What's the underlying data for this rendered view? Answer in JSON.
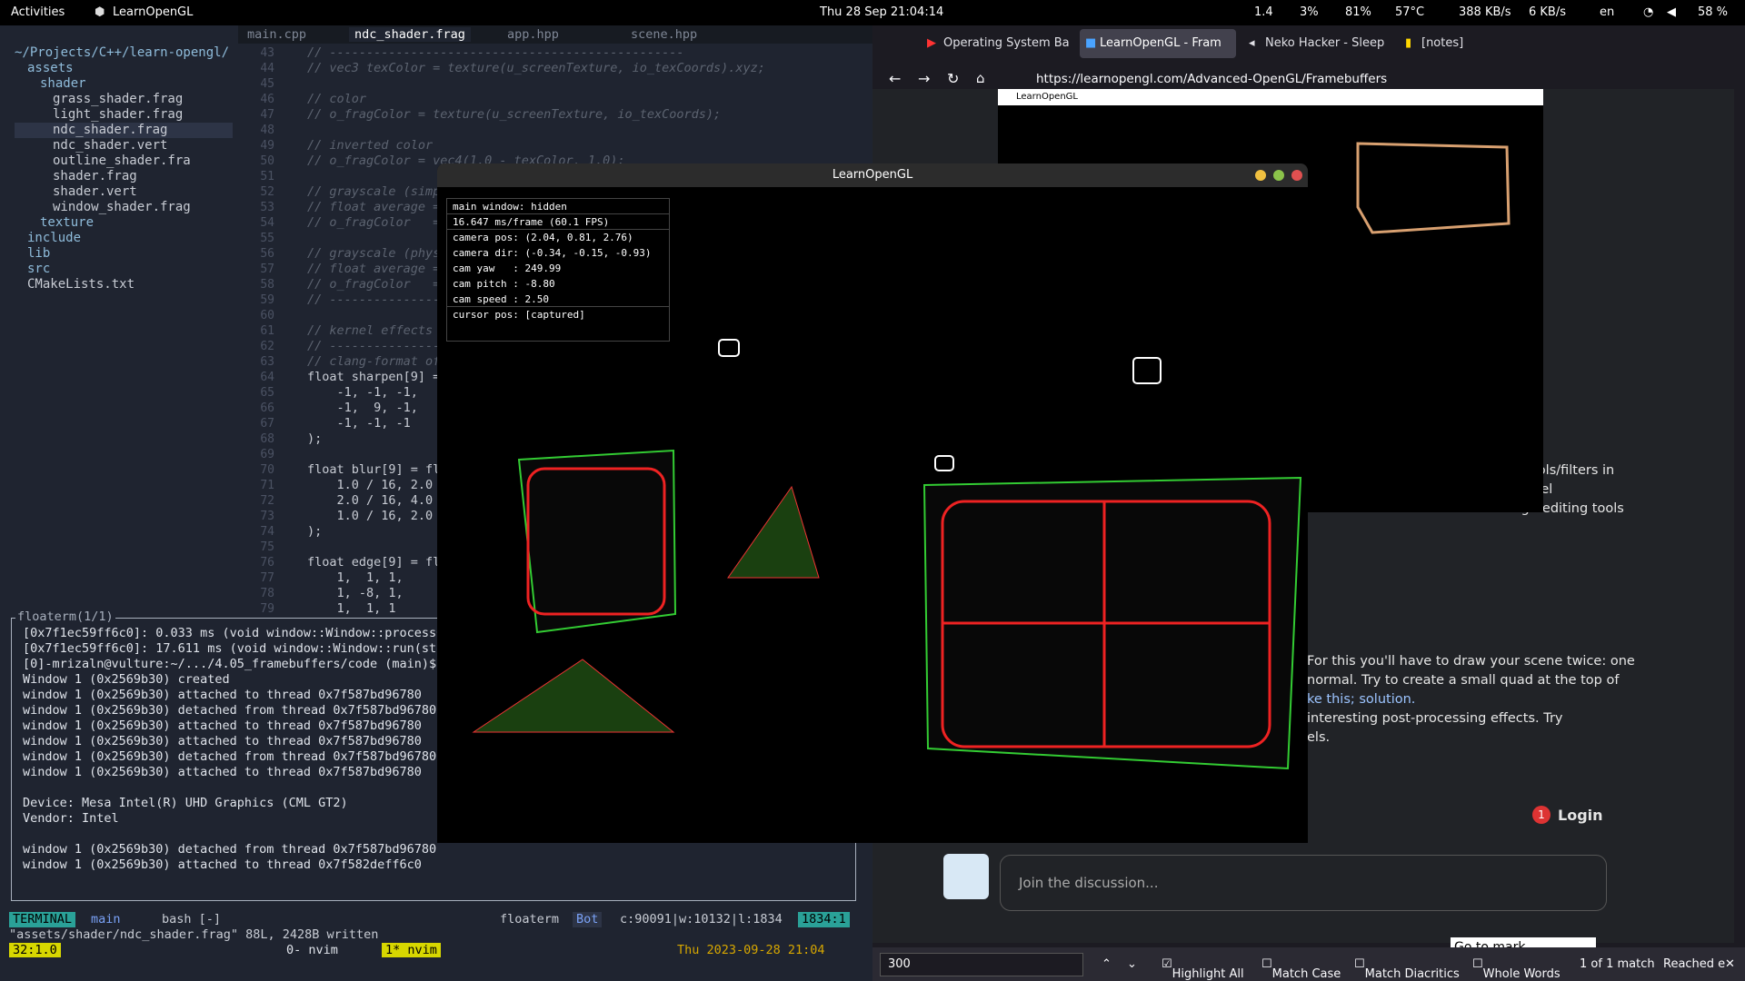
{
  "topbar": {
    "activities": "Activities",
    "app": "LearnOpenGL",
    "clock": "Thu 28 Sep  21:04:14",
    "load": "1.4",
    "cpu": "3%",
    "mem": "81%",
    "temp": "57°C",
    "down": "388 KB/s",
    "up": "6 KB/s",
    "lang": "en",
    "battery": "58 %"
  },
  "editor": {
    "tabs": [
      "main.cpp",
      "ndc_shader.frag",
      "app.hpp",
      "scene.hpp"
    ],
    "tree": [
      "~/Projects/C++/learn-opengl/",
      "assets",
      "shader",
      "grass_shader.frag",
      "light_shader.frag",
      "ndc_shader.frag",
      "ndc_shader.vert",
      "outline_shader.fra",
      "shader.frag",
      "shader.vert",
      "window_shader.frag",
      "texture",
      "include",
      "lib",
      "src",
      "CMakeLists.txt"
    ],
    "lines": [
      "43",
      "44",
      "45",
      "46",
      "47",
      "48",
      "49",
      "50",
      "51",
      "52",
      "53",
      "54",
      "55",
      "56",
      "57",
      "58",
      "59",
      "60",
      "61",
      "62",
      "63",
      "64",
      "65",
      "66",
      "67",
      "68",
      "69",
      "70",
      "71",
      "72",
      "73",
      "74",
      "75",
      "76",
      "77",
      "78",
      "79"
    ],
    "code": [
      "// ------------------------------------------------",
      "// vec3 texColor = texture(u_screenTexture, io_texCoords).xyz;",
      "",
      "// color",
      "// o_fragColor = texture(u_screenTexture, io_texCoords);",
      "",
      "// inverted color",
      "// o_fragColor = vec4(1.0 - texColor, 1.0);",
      "",
      "// grayscale (simple)",
      "// float average = (texColor.r + texColor.g + texColor.b) / 3.0;",
      "// o_fragColor   = vec4(average, average, average, 1.0);",
      "",
      "// grayscale (physically accurate)",
      "// float average = 0.2126 * texColor.r + 0.7152 * texColor.g;",
      "// o_fragColor   = vec4(average, average, average, 1.0);",
      "// ------------------------------------------------",
      "",
      "// kernel effects",
      "// ------------------------------------------------",
      "// clang-format off",
      "float sharpen[9] = float[](",
      "    -1, -1, -1,",
      "    -1,  9, -1,",
      "    -1, -1, -1",
      ");",
      "",
      "float blur[9] = float[](",
      "    1.0 / 16, 2.0 / 16, 1.0 / 16,",
      "    2.0 / 16, 4.0 / 16, 2.0 / 16,",
      "    1.0 / 16, 2.0 / 16, 1.0 / 16",
      ");",
      "",
      "float edge[9] = float[](",
      "    1,  1, 1,",
      "    1, -8, 1,",
      "    1,  1, 1"
    ]
  },
  "floaterm": {
    "title": "floaterm(1/1)",
    "lines": [
      "[0x7f1ec59ff6c0]: 0.033 ms (void window::Window::processQueuedTask())",
      "[0x7f1ec59ff6c0]: 17.611 ms (void window::Window::run(std::function))",
      "[0]-mrizaln@vulture:~/.../4.05_framebuffers/code (main)$ ./main",
      "Window 1 (0x2569b30) created",
      "window 1 (0x2569b30) attached to thread 0x7f587bd96780",
      "window 1 (0x2569b30) detached from thread 0x7f587bd96780",
      "window 1 (0x2569b30) attached to thread 0x7f587bd96780",
      "window 1 (0x2569b30) attached to thread 0x7f587bd96780",
      "window 1 (0x2569b30) detached from thread 0x7f587bd96780",
      "window 1 (0x2569b30) attached to thread 0x7f587bd96780",
      "",
      "Device: Mesa Intel(R) UHD Graphics (CML GT2)",
      "Vendor: Intel",
      "",
      "window 1 (0x2569b30) detached from thread 0x7f587bd96780",
      "window 1 (0x2569b30) attached to thread 0x7f582deff6c0"
    ]
  },
  "status": {
    "mode": "TERMINAL",
    "branch": "main",
    "shell": "bash [-]",
    "name": "floaterm",
    "pos": "Bot",
    "stats": "c:90091|w:10132|l:1834",
    "lc": "1834:1",
    "msg": "\"assets/shader/ndc_shader.frag\" 88L, 2428B written",
    "cursor": "32:1.0",
    "tmux": "0- nvim",
    "tmux2": "1* nvim",
    "date": "Thu  2023-09-28  21:04"
  },
  "browser": {
    "tabs": [
      "Operating System Ba",
      "LearnOpenGL - Fram",
      "Neko Hacker - Sleep",
      "[notes]"
    ],
    "url": "https://learnopengl.com/Advanced-OpenGL/Framebuffers",
    "para1": [
      "are used as image-manipulating tools/filters in",
      "cess fragments with extreme parallel",
      "real-time with relative ease. Image-editing tools"
    ],
    "para2": [
      "For this you'll have to draw your scene twice: one",
      "normal. Try to create a small quad at the top of",
      "ke this; solution.",
      "interesting post-processing effects. Try",
      "els."
    ],
    "login": "Login",
    "discussion": "Join the discussion...",
    "gotomark": "Go to mark...",
    "find": {
      "value": "300",
      "highlight": "Highlight All",
      "case": "Match Case",
      "diacritics": "Match Diacritics",
      "whole": "Whole Words",
      "count": "1 of 1 match",
      "reached": "Reached e"
    }
  },
  "glsmall": {
    "title": "LearnOpenGL"
  },
  "glwin": {
    "title": "LearnOpenGL",
    "overlay": [
      "main window: hidden",
      "16.647 ms/frame (60.1 FPS)",
      "camera pos: (2.04, 0.81, 2.76)",
      "camera dir: (-0.34, -0.15, -0.93)",
      "cam yaw   : 249.99",
      "cam pitch : -8.80",
      "cam speed : 2.50",
      "cursor pos: [captured]"
    ]
  }
}
